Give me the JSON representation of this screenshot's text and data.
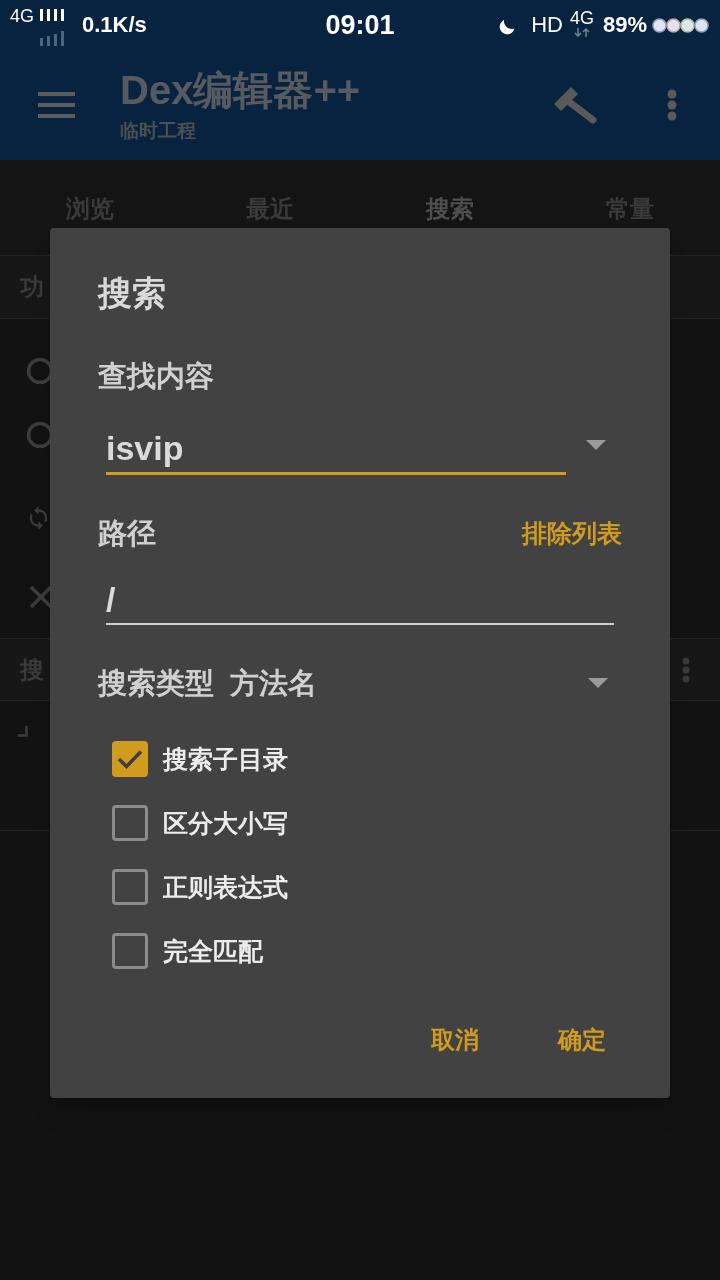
{
  "status_bar": {
    "network": "4G",
    "speed": "0.1K/s",
    "time": "09:01",
    "hd": "HD",
    "data_network": "4G",
    "battery": "89%"
  },
  "app_bar": {
    "title": "Dex编辑器++",
    "subtitle": "临时工程"
  },
  "tabs": [
    {
      "label": "浏览",
      "selected": false
    },
    {
      "label": "最近",
      "selected": false
    },
    {
      "label": "搜索",
      "selected": true
    },
    {
      "label": "常量",
      "selected": false
    }
  ],
  "sections": [
    {
      "title": "功"
    },
    {
      "title": "搜"
    }
  ],
  "dialog": {
    "title": "搜索",
    "find": {
      "label": "查找内容",
      "value": "isvip",
      "focused": true
    },
    "path": {
      "label": "路径",
      "value": "/",
      "focused": false,
      "link": "排除列表"
    },
    "search_type": {
      "label": "搜索类型",
      "value": "方法名"
    },
    "options": [
      {
        "label": "搜索子目录",
        "checked": true
      },
      {
        "label": "区分大小写",
        "checked": false
      },
      {
        "label": "正则表达式",
        "checked": false
      },
      {
        "label": "完全匹配",
        "checked": false
      }
    ],
    "buttons": [
      "取消",
      "确定"
    ]
  }
}
